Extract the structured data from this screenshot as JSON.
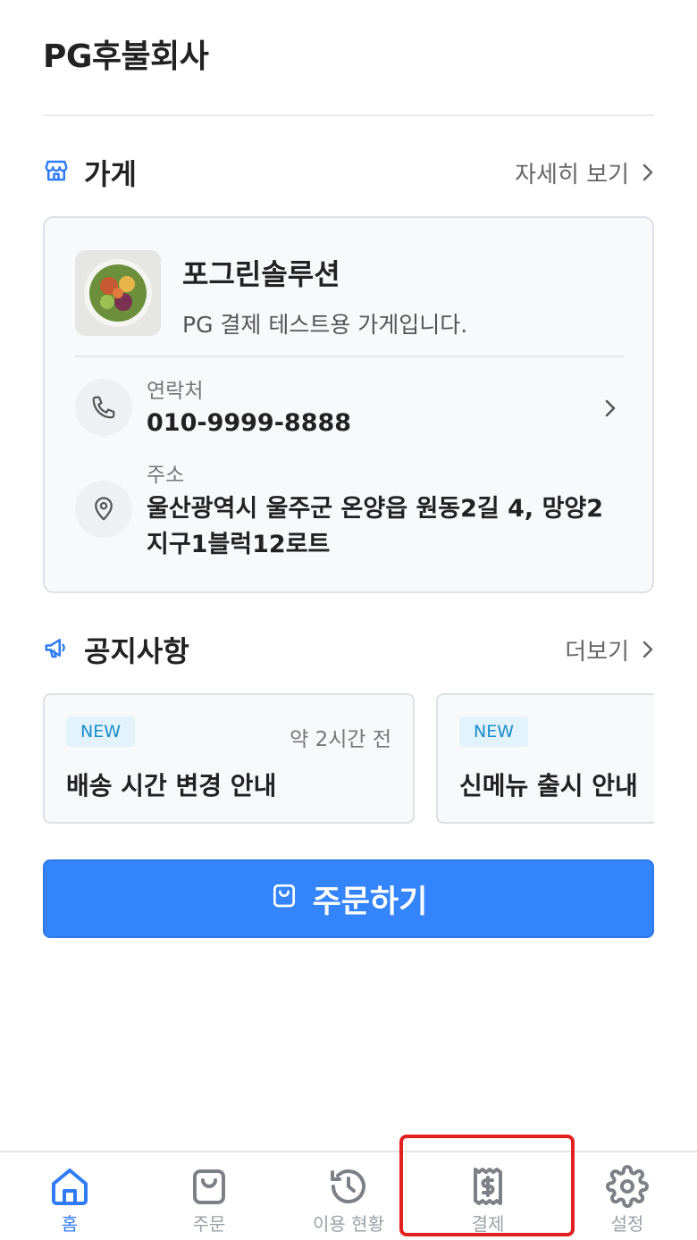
{
  "header": {
    "title": "PG후불회사"
  },
  "store_section": {
    "title": "가게",
    "link": "자세히 보기"
  },
  "store": {
    "name": "포그린솔루션",
    "description": "PG 결제 테스트용 가게입니다.",
    "contact_label": "연락처",
    "contact_value": "010-9999-8888",
    "address_label": "주소",
    "address_line1": "울산광역시 울주군 온양읍 원동2길 4, 망양2",
    "address_line2": "지구1블럭12로트"
  },
  "notice_section": {
    "title": "공지사항",
    "link": "더보기"
  },
  "notices": [
    {
      "badge": "NEW",
      "time": "약 2시간 전",
      "title": "배송 시간 변경 안내"
    },
    {
      "badge": "NEW",
      "time": "",
      "title": "신메뉴 출시 안내"
    }
  ],
  "order_button": {
    "label": "주문하기"
  },
  "bottom_nav": [
    {
      "label": "홈",
      "icon": "home-icon",
      "active": true
    },
    {
      "label": "주문",
      "icon": "shopping-bag-icon",
      "active": false
    },
    {
      "label": "이용 현황",
      "icon": "history-icon",
      "active": false
    },
    {
      "label": "결제",
      "icon": "receipt-icon",
      "active": false
    },
    {
      "label": "설정",
      "icon": "gear-icon",
      "active": false
    }
  ],
  "colors": {
    "accent": "#3484fb",
    "highlight": "#e32020"
  }
}
